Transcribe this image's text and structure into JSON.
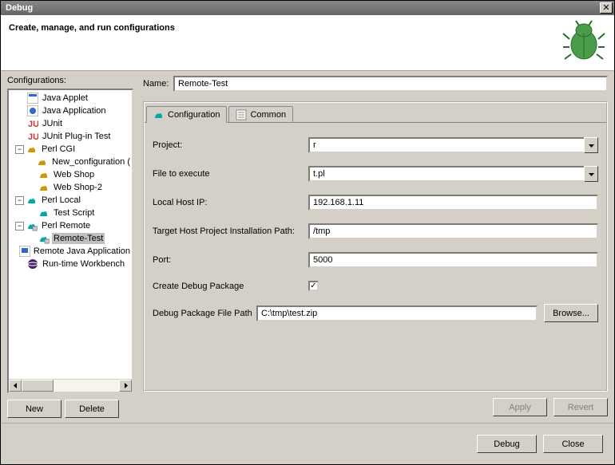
{
  "titlebar": {
    "title": "Debug"
  },
  "header": {
    "title": "Create, manage, and run configurations"
  },
  "left": {
    "label": "Configurations:",
    "newBtn": "New",
    "deleteBtn": "Delete"
  },
  "tree": {
    "javaApplet": "Java Applet",
    "javaApplication": "Java Application",
    "junit": "JUnit",
    "junitPlugin": "JUnit Plug-in Test",
    "perlCgi": "Perl CGI",
    "newConfig": "New_configuration (",
    "webShop": "Web Shop",
    "webShop2": "Web Shop-2",
    "perlLocal": "Perl Local",
    "testScript": "Test Script",
    "perlRemote": "Perl Remote",
    "remoteTest": "Remote-Test",
    "remoteJava": "Remote Java Application",
    "runtimeWb": "Run-time Workbench"
  },
  "form": {
    "nameLabel": "Name:",
    "nameValue": "Remote-Test",
    "tabConfig": "Configuration",
    "tabCommon": "Common",
    "projectLabel": "Project:",
    "projectValue": "r",
    "fileLabel": "File to execute",
    "fileValue": "t.pl",
    "localHostLabel": "Local Host IP:",
    "localHostValue": "192.168.1.11",
    "targetPathLabel": "Target Host Project Installation Path:",
    "targetPathValue": "/tmp",
    "portLabel": "Port:",
    "portValue": "5000",
    "createPkgLabel": "Create Debug Package",
    "createPkgChecked": true,
    "pkgPathLabel": "Debug Package File Path",
    "pkgPathValue": "C:\\tmp\\test.zip",
    "browseBtn": "Browse...",
    "applyBtn": "Apply",
    "revertBtn": "Revert"
  },
  "footer": {
    "debugBtn": "Debug",
    "closeBtn": "Close"
  }
}
